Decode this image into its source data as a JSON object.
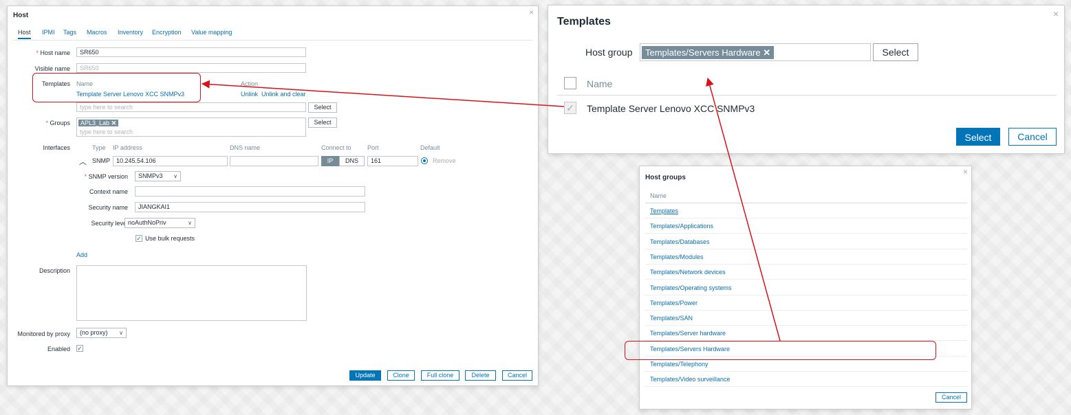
{
  "host_dialog": {
    "title": "Host",
    "close": "×",
    "tabs": [
      "Host",
      "IPMI",
      "Tags",
      "Macros",
      "Inventory",
      "Encryption",
      "Value mapping"
    ],
    "host_name_label": "Host name",
    "host_name_value": "SR650",
    "visible_name_label": "Visible name",
    "visible_name_placeholder": "SR650",
    "templates_label": "Templates",
    "templates_col_name": "Name",
    "templates_col_action": "Action",
    "template_item": "Template Server Lenovo XCC SNMPv3",
    "unlink": "Unlink",
    "unlink_clear": "Unlink and clear",
    "search_placeholder": "type here to search",
    "select": "Select",
    "groups_label": "Groups",
    "group_chip": "APL3_Lab",
    "interfaces_label": "Interfaces",
    "iface_cols": {
      "type": "Type",
      "ip": "IP address",
      "dns": "DNS name",
      "connect": "Connect to",
      "port": "Port",
      "default": "Default"
    },
    "iface_type": "SNMP",
    "ip_value": "10.245.54.106",
    "connect_ip": "IP",
    "connect_dns": "DNS",
    "port_value": "161",
    "remove": "Remove",
    "snmp_version_label": "SNMP version",
    "snmp_version_value": "SNMPv3",
    "context_name_label": "Context name",
    "security_name_label": "Security name",
    "security_name_value": "JIANGKAI1",
    "security_level_label": "Security level",
    "security_level_value": "noAuthNoPriv",
    "bulk_label": "Use bulk requests",
    "add": "Add",
    "description_label": "Description",
    "proxy_label": "Monitored by proxy",
    "proxy_value": "(no proxy)",
    "enabled_label": "Enabled",
    "buttons": {
      "update": "Update",
      "clone": "Clone",
      "full_clone": "Full clone",
      "delete": "Delete",
      "cancel": "Cancel"
    }
  },
  "templates_dialog": {
    "title": "Templates",
    "close": "×",
    "host_group_label": "Host group",
    "host_group_chip": "Templates/Servers Hardware",
    "select": "Select",
    "col_name": "Name",
    "row": "Template Server Lenovo XCC SNMPv3",
    "btn_select": "Select",
    "btn_cancel": "Cancel"
  },
  "host_groups_dialog": {
    "title": "Host groups",
    "close": "×",
    "col_name": "Name",
    "items": [
      "Templates",
      "Templates/Applications",
      "Templates/Databases",
      "Templates/Modules",
      "Templates/Network devices",
      "Templates/Operating systems",
      "Templates/Power",
      "Templates/SAN",
      "Templates/Server hardware",
      "Templates/Servers Hardware",
      "Templates/Telephony",
      "Templates/Video surveillance"
    ],
    "cancel": "Cancel"
  },
  "annotation_color": "#d8131a",
  "accent_color": "#0275b8"
}
